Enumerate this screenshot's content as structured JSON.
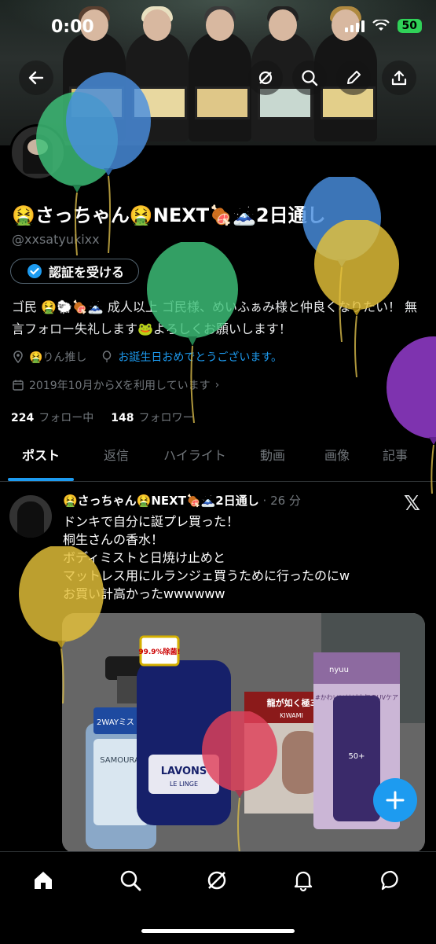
{
  "status": {
    "time": "0:00",
    "battery": "50"
  },
  "profile": {
    "name": "🤮さっちゃん🤮NEXT🍖🗻2日通し",
    "handle": "@xxsatyukixx",
    "verify_label": "認証を受ける",
    "bio": "ゴ民 🤮🐑🍖🗻 成人以上 ゴ民様、めいふぁみ様と仲良くなりたい！ 無言フォロー失礼します🐸よろしくお願いします！",
    "oshi": "🤮りん推し",
    "birthday_link": "お誕生日おめでとうございます。",
    "joined": "2019年10月からXを利用しています",
    "following_count": "224",
    "following_label": "フォロー中",
    "followers_count": "148",
    "followers_label": "フォロワー"
  },
  "tabs": [
    {
      "label": "ポスト"
    },
    {
      "label": "返信"
    },
    {
      "label": "ハイライト"
    },
    {
      "label": "動画"
    },
    {
      "label": "画像"
    },
    {
      "label": "記事"
    }
  ],
  "post": {
    "author": "🤮さっちゃん🤮NEXT🍖🗻2日通し",
    "time": "· 26 分",
    "lines": [
      "ドンキで自分に誕プレ買った！",
      "桐生さんの香水！",
      "ボディミストと日焼け止めと",
      "マットレス用にルランジェ買うために行ったのにw",
      "お買い計高かったwwwwww"
    ],
    "media": {
      "samourai": "SAMOURAI",
      "twoway": "2WAYミスト",
      "percent": "99.9%除菌!",
      "lavons": "LAVONS",
      "lavons_sub": "LE LINGE",
      "ryu": "龍が如く極3",
      "ryu_sub": "KIWAMI",
      "nyuu": "nyuu",
      "nyuu_copy": "#かわいいけど本気のUVケア",
      "spf": "50+"
    }
  },
  "icons": {
    "back": "arrow-left-icon",
    "grok": "grok-icon",
    "search": "search-icon",
    "edit": "pencil-icon",
    "share": "share-icon",
    "location": "location-icon",
    "calendar": "calendar-icon",
    "home": "home-icon",
    "notifications": "bell-icon",
    "messages": "message-icon"
  },
  "colors": {
    "accent": "#1d9bf0",
    "background": "#000000",
    "muted": "#71767b"
  }
}
